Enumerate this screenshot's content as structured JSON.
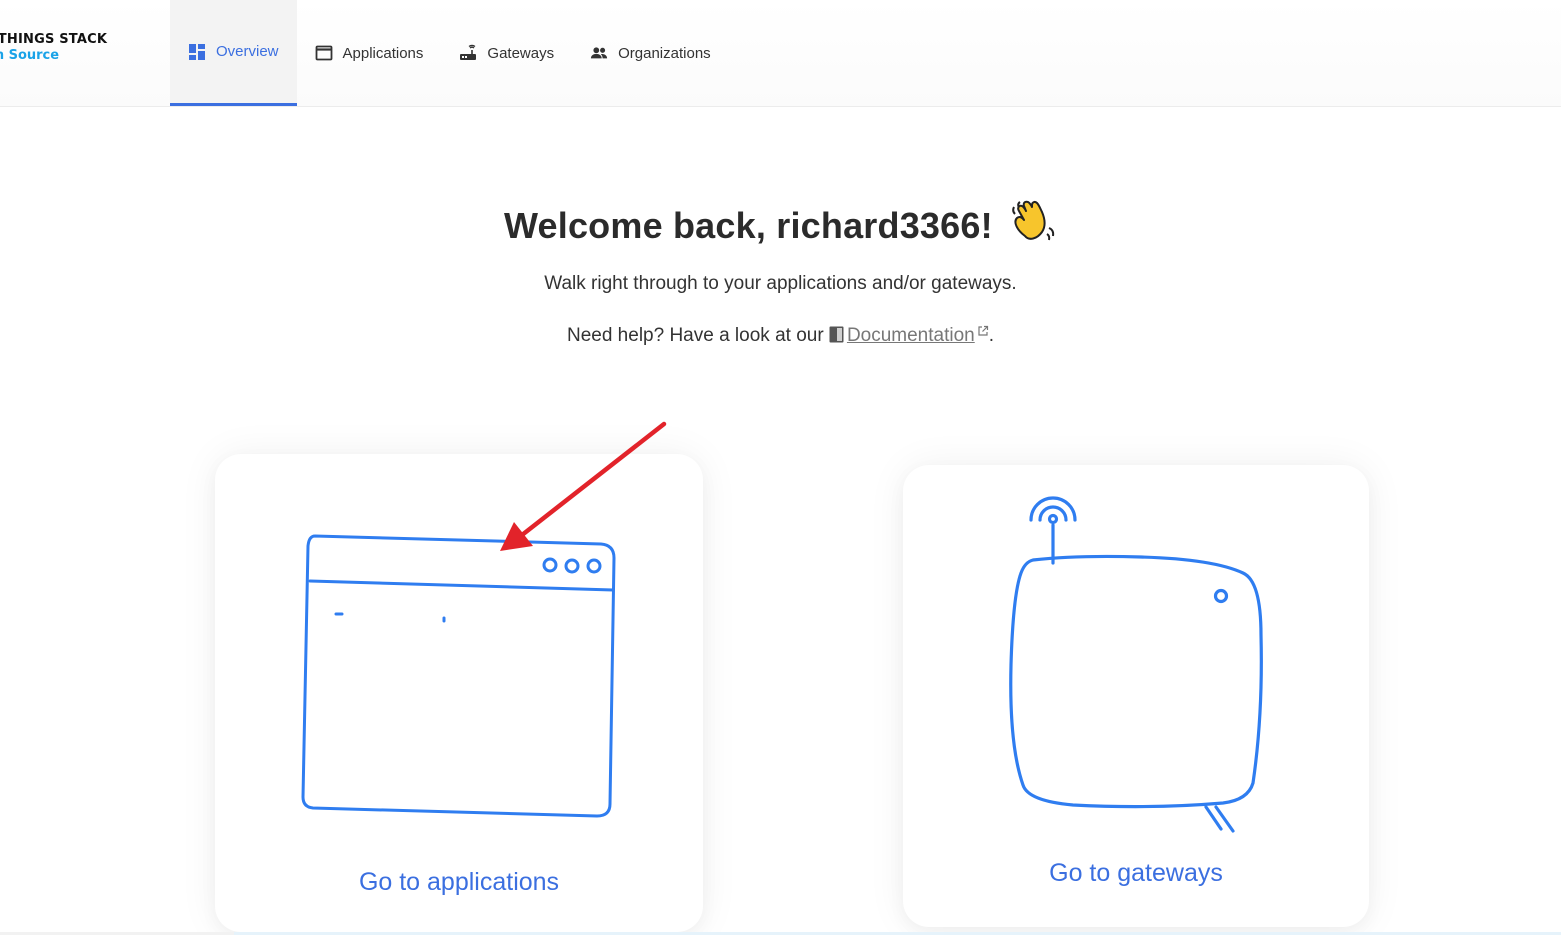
{
  "app": {
    "logo_line1": "E THINGS STACK",
    "logo_line2": "en Source"
  },
  "nav": {
    "items": [
      {
        "label": "Overview",
        "icon": "dashboard-icon",
        "active": true
      },
      {
        "label": "Applications",
        "icon": "window-icon",
        "active": false
      },
      {
        "label": "Gateways",
        "icon": "router-icon",
        "active": false
      },
      {
        "label": "Organizations",
        "icon": "people-icon",
        "active": false
      }
    ]
  },
  "main": {
    "welcome": "Welcome back, richard3366!",
    "subtitle": "Walk right through to your applications and/or gateways.",
    "help_prefix": "Need help? Have a look at our",
    "doc_link": "Documentation",
    "help_suffix": "."
  },
  "cards": {
    "applications_label": "Go to applications",
    "gateways_label": "Go to gateways"
  },
  "colors": {
    "accent": "#3b6fe0",
    "illustration": "#2f7df0",
    "annotation_arrow": "#e2232a",
    "logo_blue": "#1aa3e8"
  }
}
